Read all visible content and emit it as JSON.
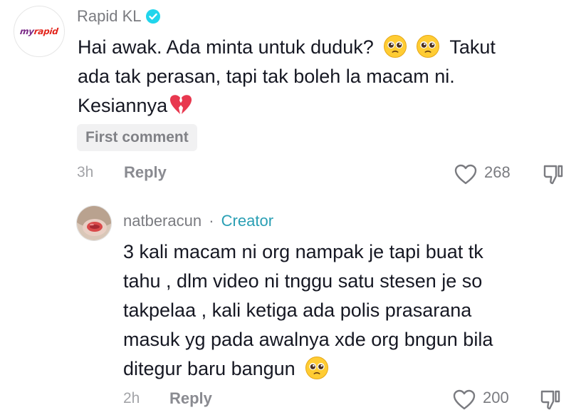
{
  "colors": {
    "verified": "#20d5ec",
    "creator": "#2a9fb4",
    "heart_outline": "#7a7b80",
    "emoji_face": "#ffcc33",
    "broken_heart": "#e8384f"
  },
  "comment1": {
    "brand_logo_text_a": "my",
    "brand_logo_text_b": "rapid",
    "username": "Rapid KL",
    "verified_icon": "verified-badge-icon",
    "lines": [
      "Hai awak. Ada minta untuk duduk?",
      "Takut",
      "ada tak perasan, tapi tak boleh la macam ni.",
      "Kesiannya"
    ],
    "emojis": [
      "pleading-face",
      "pleading-face",
      "broken-heart"
    ],
    "badge": "First comment",
    "time": "3h",
    "reply_label": "Reply",
    "likes": "268"
  },
  "comment2": {
    "username": "natberacun",
    "separator": "·",
    "role": "Creator",
    "lines": [
      "3 kali macam ni org nampak je tapi buat tk",
      "tahu , dlm video ni tnggu satu stesen je so",
      "takpelaa , kali ketiga ada polis prasarana",
      "masuk yg pada awalnya xde org bngun bila",
      "ditegur baru bangun"
    ],
    "emojis": [
      "pleading-face"
    ],
    "time": "2h",
    "reply_label": "Reply",
    "likes": "200"
  }
}
